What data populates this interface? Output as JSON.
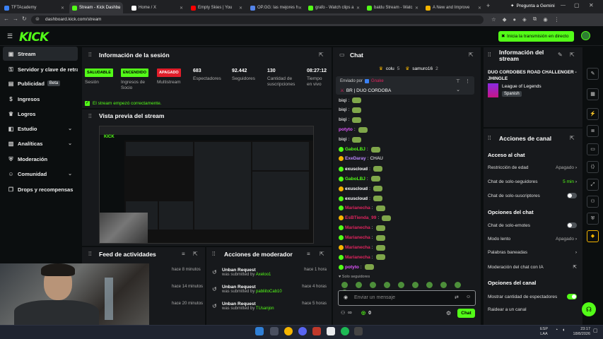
{
  "browser": {
    "tabs": [
      {
        "label": "TFTAcademy",
        "color": "#3b82f6"
      },
      {
        "label": "Stream - Kick Dashbo",
        "color": "#53fc18"
      },
      {
        "label": "Home / X",
        "color": "#ffffff"
      },
      {
        "label": "Empty Skies | You",
        "color": "#ff0000"
      },
      {
        "label": "OP.GG: las mejores h",
        "color": "#5383e8"
      },
      {
        "label": "grafo - Watch clips a",
        "color": "#53fc18"
      },
      {
        "label": "baldu Stream - Watc",
        "color": "#53fc18"
      },
      {
        "label": "A New and Improve",
        "color": "#f4b400"
      }
    ],
    "gemini_label": "Pregunta a Gemini",
    "url": "dashboard.kick.com/stream"
  },
  "header": {
    "logo": "KICK",
    "start_transmission_label": "Inicia la transmisión en directo"
  },
  "sidebar": {
    "items": [
      {
        "label": "Stream",
        "icon": "stream-icon"
      },
      {
        "label": "Servidor y clave de retran",
        "icon": "key-icon"
      },
      {
        "label": "Publicidad",
        "icon": "ad-icon",
        "badge": "Beta"
      },
      {
        "label": "Ingresos",
        "icon": "money-icon"
      },
      {
        "label": "Logros",
        "icon": "trophy-icon"
      },
      {
        "label": "Estudio",
        "icon": "studio-icon"
      },
      {
        "label": "Analíticas",
        "icon": "chart-icon"
      },
      {
        "label": "Moderación",
        "icon": "shield-icon"
      },
      {
        "label": "Comunidad",
        "icon": "people-icon"
      },
      {
        "label": "Drops y recompensas",
        "icon": "gift-icon"
      }
    ]
  },
  "session": {
    "title": "Información de la sesión",
    "stats": [
      {
        "pill": "SALUDABLE",
        "pill_color": "#53fc18",
        "label": "Sesión"
      },
      {
        "pill": "ENCENDIDO",
        "pill_color": "#53fc18",
        "label": "Ingresos de Socio"
      },
      {
        "pill": "APAGADO",
        "pill_color": "#e11d2a",
        "label": "Multistream"
      },
      {
        "value": "683",
        "label": "Espectadores"
      },
      {
        "value": "92.442",
        "label": "Seguidores"
      },
      {
        "value": "130",
        "label": "Cantidad de suscripciones"
      },
      {
        "value": "08:27:12",
        "label": "Tiempo en vivo"
      }
    ],
    "status_message": "El stream empezó correctamente."
  },
  "preview": {
    "title": "Vista previa del stream"
  },
  "activity_feed": {
    "title": "Feed de actividades",
    "times": [
      "hace 8 minutos",
      "hace 14 minutos",
      "hace 20 minutos"
    ]
  },
  "mod_actions": {
    "title": "Acciones de moderador",
    "rows": [
      {
        "title": "Unban Request",
        "submitted": "was submitted by",
        "user": "Axeloo1",
        "time": "hace 1 hora"
      },
      {
        "title": "Unban Request",
        "submitted": "was submitted by",
        "user": "pabliitoCab10",
        "time": "hace 4 horas"
      },
      {
        "title": "Unban Request",
        "submitted": "was submitted by",
        "user": "TUsanjon",
        "time": "hace 5 horas"
      }
    ]
  },
  "chat": {
    "title": "Chat",
    "top_gifters": [
      {
        "name": "colu",
        "count": "5"
      },
      {
        "name": "samuro16",
        "count": "2"
      }
    ],
    "pinned": {
      "label": "Enviado por",
      "user": "Gnake",
      "message": "BR | DUO CORDOBA"
    },
    "messages": [
      {
        "user": "biqi",
        "color": "#cfcfcf",
        "text": ""
      },
      {
        "user": "biqi",
        "color": "#cfcfcf",
        "text": ""
      },
      {
        "user": "biqi",
        "color": "#cfcfcf",
        "text": ""
      },
      {
        "user": "potyto",
        "color": "#e056fd",
        "text": ""
      },
      {
        "user": "biqi",
        "color": "#cfcfcf",
        "text": ""
      },
      {
        "user": "GaboLBJ",
        "color": "#53fc18",
        "text": ""
      },
      {
        "user": "ExeDaray",
        "color": "#bb86fc",
        "text": "CHAU"
      },
      {
        "user": "exuscloud",
        "color": "#ffffff",
        "text": ""
      },
      {
        "user": "GaboLBJ",
        "color": "#53fc18",
        "text": ""
      },
      {
        "user": "exuscloud",
        "color": "#ffffff",
        "text": ""
      },
      {
        "user": "exuscloud",
        "color": "#ffffff",
        "text": ""
      },
      {
        "user": "Marianecha",
        "color": "#e0245e",
        "text": ""
      },
      {
        "user": "EsBTienda_99",
        "color": "#e0245e",
        "text": ""
      },
      {
        "user": "Marianecha",
        "color": "#e0245e",
        "text": ""
      },
      {
        "user": "Marianecha",
        "color": "#e0245e",
        "text": ""
      },
      {
        "user": "Marianecha",
        "color": "#e0245e",
        "text": ""
      },
      {
        "user": "Marianecha",
        "color": "#e0245e",
        "text": ""
      },
      {
        "user": "potyto",
        "color": "#e056fd",
        "text": ""
      }
    ],
    "followers_only_label": "Solo seguidores",
    "input_placeholder": "Enviar un mensaje",
    "points": "0",
    "send_label": "Chat"
  },
  "stream_info": {
    "title": "Información del stream",
    "stream_title": "DUO CORDOBES ROAD CHALLENGER - JHINGLE",
    "game": "League of Legends",
    "language": "Spanish"
  },
  "channel_actions": {
    "title": "Acciones de canal",
    "chat_access_heading": "Acceso al chat",
    "age_restriction": {
      "label": "Restricción de edad",
      "value": "Apagado"
    },
    "followers_only": {
      "label": "Chat de solo-seguidores",
      "value": "5 min"
    },
    "subs_only": {
      "label": "Chat de solo-suscriptores",
      "enabled": false
    },
    "chat_options_heading": "Opciones del chat",
    "emotes_only": {
      "label": "Chat de solo-emotes",
      "enabled": false
    },
    "slow_mode": {
      "label": "Modo lento",
      "value": "Apagado"
    },
    "banned_words": {
      "label": "Palabras baneadas"
    },
    "ai_moderation": {
      "label": "Moderación del chat con IA"
    },
    "channel_options_heading": "Opciones del canal",
    "show_viewers": {
      "label": "Mostrar cantidad de espectadores",
      "enabled": true
    },
    "raid": {
      "label": "Raidear a un canal"
    }
  },
  "taskbar": {
    "lang": "ESP",
    "layout": "LAA",
    "time": "23:17",
    "date": "18/8/2026"
  },
  "colors": {
    "accent": "#53fc18",
    "danger": "#e11d2a",
    "panel": "#17191c",
    "bg": "#0b0e0f"
  }
}
